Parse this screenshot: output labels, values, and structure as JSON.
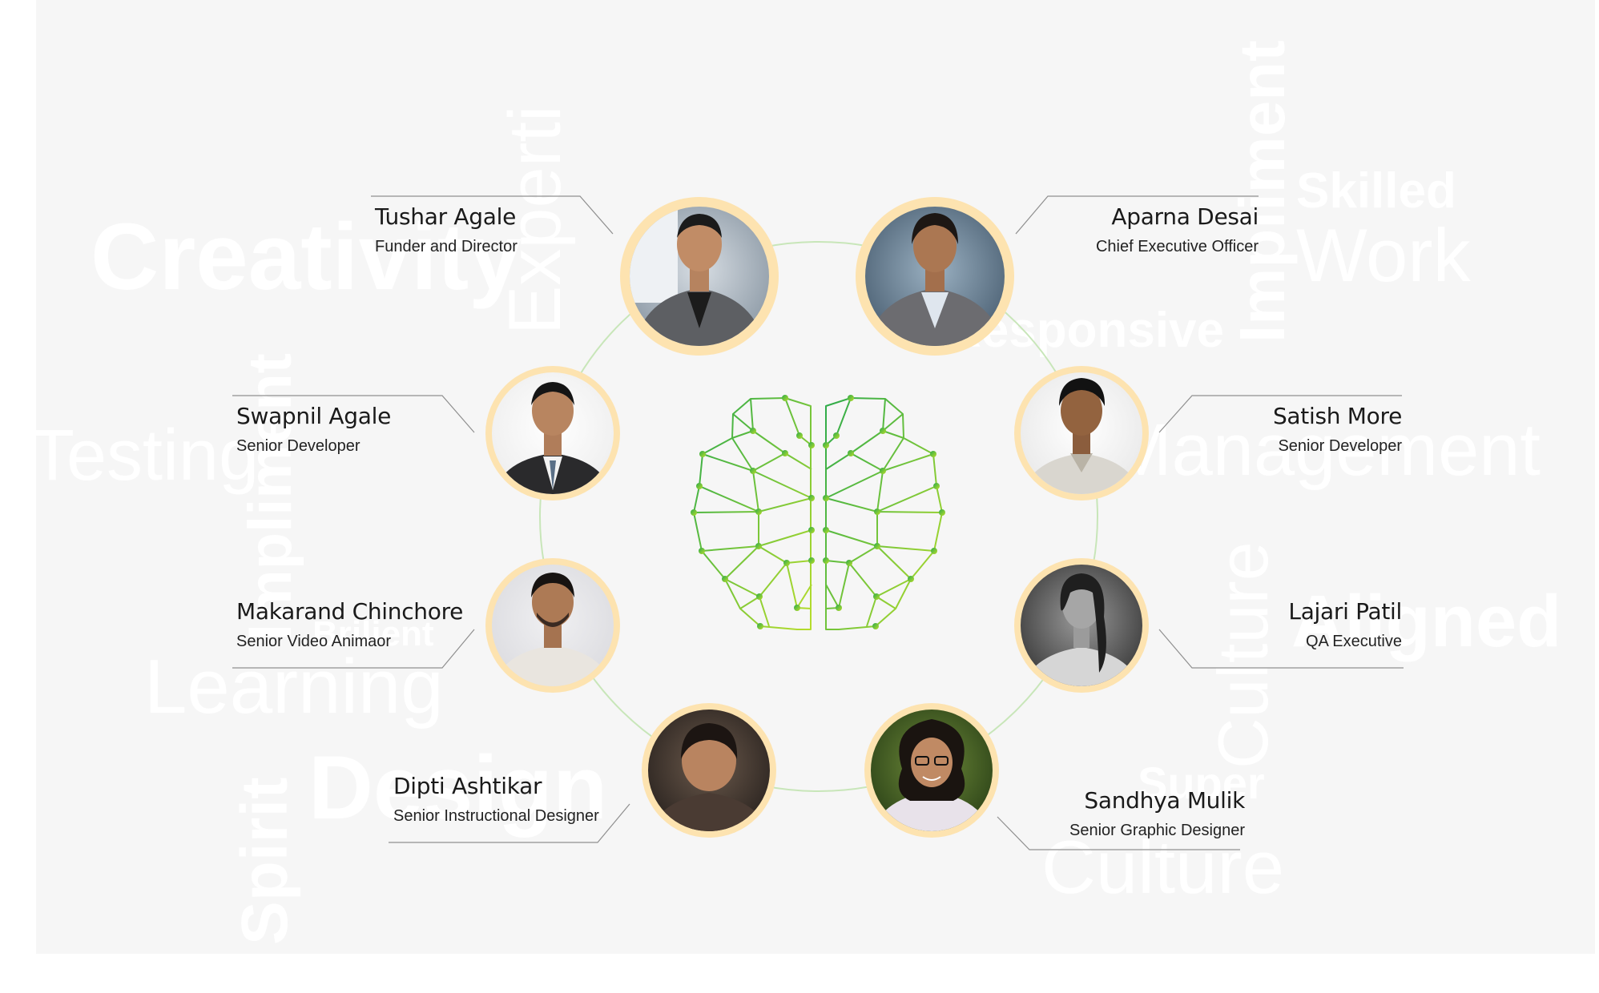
{
  "background_words": [
    {
      "text": "Creativity",
      "style": "bold"
    },
    {
      "text": "Experti",
      "style": "light"
    },
    {
      "text": "Skilled",
      "style": "bold"
    },
    {
      "text": "Work",
      "style": "light"
    },
    {
      "text": "Impliment",
      "style": "bold"
    },
    {
      "text": "Responsive",
      "style": "bold"
    },
    {
      "text": "Testing",
      "style": "light"
    },
    {
      "text": "Impliment",
      "style": "bold"
    },
    {
      "text": "Management",
      "style": "light"
    },
    {
      "text": "Aligned",
      "style": "bold"
    },
    {
      "text": "Brilient",
      "style": "bold"
    },
    {
      "text": "Learning",
      "style": "light"
    },
    {
      "text": "Culture",
      "style": "light"
    },
    {
      "text": "Spirit",
      "style": "bold"
    },
    {
      "text": "Design",
      "style": "bold"
    },
    {
      "text": "Super",
      "style": "bold"
    },
    {
      "text": "Culture",
      "style": "light"
    }
  ],
  "team": [
    {
      "name": "Tushar Agale",
      "role": "Funder and Director",
      "photo": "man-in-blazer-photo"
    },
    {
      "name": "Aparna Desai",
      "role": "Chief Executive Officer",
      "photo": "woman-in-blazer-photo"
    },
    {
      "name": "Swapnil Agale",
      "role": "Senior Developer",
      "photo": "man-in-suit-photo"
    },
    {
      "name": "Satish More",
      "role": "Senior Developer",
      "photo": "man-in-shirt-photo"
    },
    {
      "name": "Makarand Chinchore",
      "role": "Senior Video Animaor",
      "photo": "man-with-beard-photo"
    },
    {
      "name": "Lajari Patil",
      "role": "QA Executive",
      "photo": "woman-monochrome-photo"
    },
    {
      "name": "Dipti Ashtikar",
      "role": "Senior Instructional Designer",
      "photo": "woman-portrait-photo"
    },
    {
      "name": "Sandhya Mulik",
      "role": "Senior Graphic Designer",
      "photo": "woman-with-glasses-photo"
    }
  ],
  "colors": {
    "page_background": "#f6f6f6",
    "ring": "#fde3b0",
    "orbit": "#c8e6b9",
    "brain_dark": "#2daa4a",
    "brain_light": "#b7dd2b",
    "connector": "#8f8f8f"
  }
}
